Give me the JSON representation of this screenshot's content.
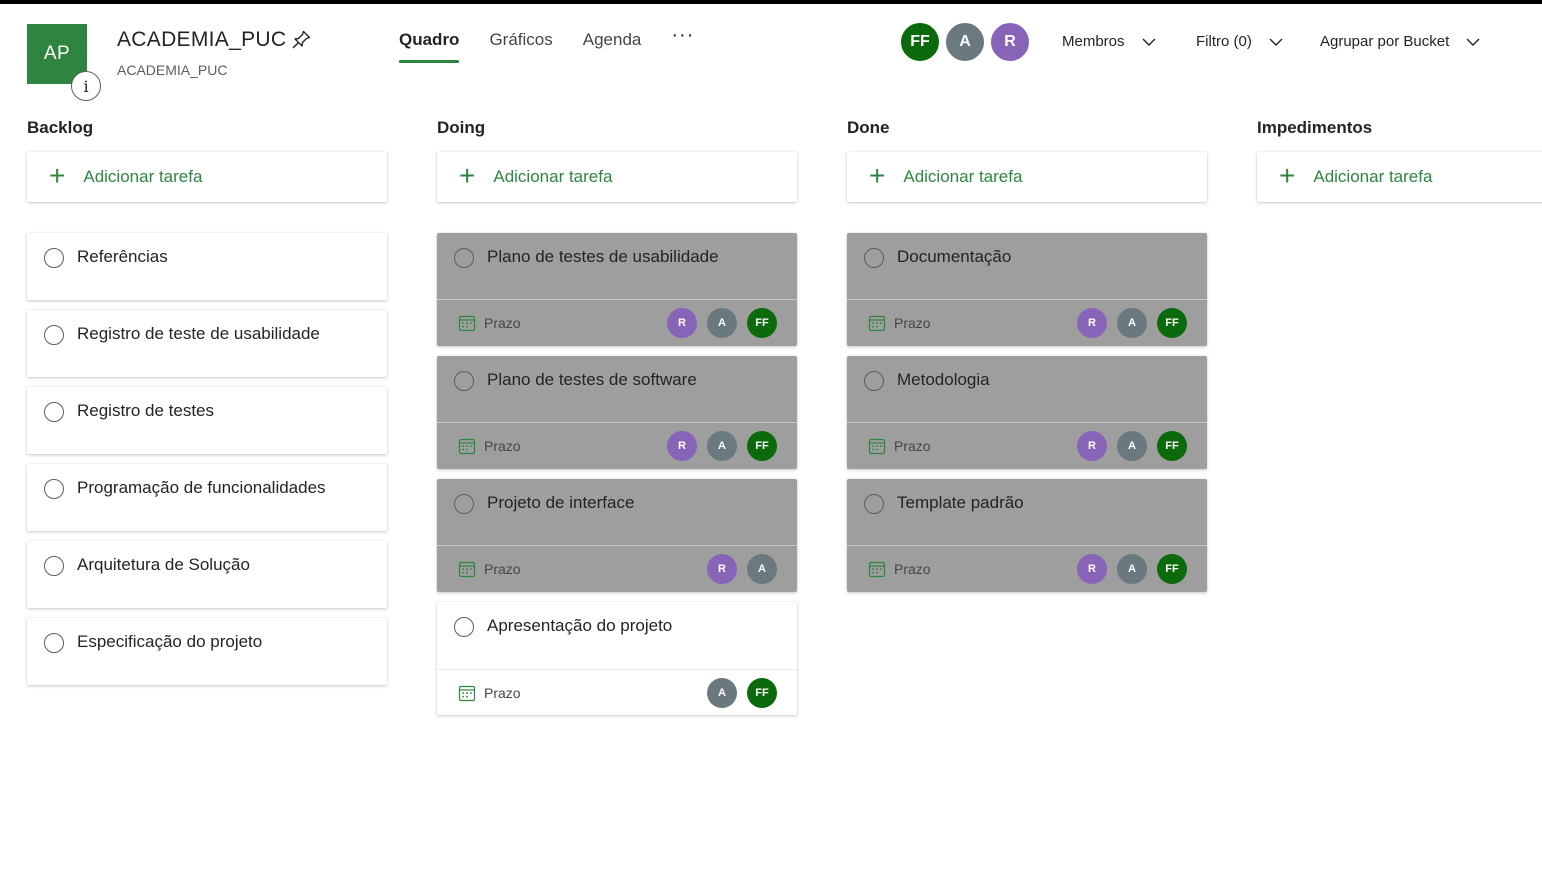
{
  "header": {
    "plan_initials": "AP",
    "info_icon_glyph": "i",
    "plan_title": "ACADEMIA_PUC",
    "plan_subtitle": "ACADEMIA_PUC",
    "tabs": [
      {
        "label": "Quadro",
        "active": true
      },
      {
        "label": "Gráficos",
        "active": false
      },
      {
        "label": "Agenda",
        "active": false
      }
    ],
    "more_label": "···",
    "members": [
      {
        "initials": "FF",
        "color": "#0b6a0b"
      },
      {
        "initials": "A",
        "color": "#69797e"
      },
      {
        "initials": "R",
        "color": "#8764b8"
      }
    ],
    "members_label": "Membros",
    "filter_label": "Filtro (0)",
    "group_label": "Agrupar por Bucket"
  },
  "colors": {
    "brand": "#2e8540",
    "done_card": "#9e9e9e",
    "avatar_R": "#8764b8",
    "avatar_A": "#69797e",
    "avatar_FF": "#0b6a0b"
  },
  "add_task_label": "Adicionar tarefa",
  "due_label": "Prazo",
  "buckets": [
    {
      "title": "Backlog",
      "tasks": [
        {
          "title": "Referências"
        },
        {
          "title": "Registro de teste de usabilidade"
        },
        {
          "title": "Registro de testes"
        },
        {
          "title": "Programação de funcionalidades"
        },
        {
          "title": "Arquitetura de Solução"
        },
        {
          "title": "Especificação do projeto"
        }
      ]
    },
    {
      "title": "Doing",
      "tasks": [
        {
          "title": "Plano de testes de usabilidade",
          "completed_style": true,
          "assignees": [
            "R",
            "A",
            "FF"
          ]
        },
        {
          "title": "Plano de testes de software",
          "completed_style": true,
          "assignees": [
            "R",
            "A",
            "FF"
          ]
        },
        {
          "title": "Projeto de interface",
          "completed_style": true,
          "assignees": [
            "R",
            "A"
          ]
        },
        {
          "title": "Apresentação do projeto",
          "completed_style": false,
          "assignees": [
            "A",
            "FF"
          ]
        }
      ]
    },
    {
      "title": "Done",
      "tasks": [
        {
          "title": "Documentação",
          "completed_style": true,
          "assignees": [
            "R",
            "A",
            "FF"
          ]
        },
        {
          "title": "Metodologia",
          "completed_style": true,
          "assignees": [
            "R",
            "A",
            "FF"
          ]
        },
        {
          "title": "Template padrão",
          "completed_style": true,
          "assignees": [
            "R",
            "A",
            "FF"
          ]
        }
      ]
    },
    {
      "title": "Impedimentos",
      "tasks": []
    }
  ]
}
